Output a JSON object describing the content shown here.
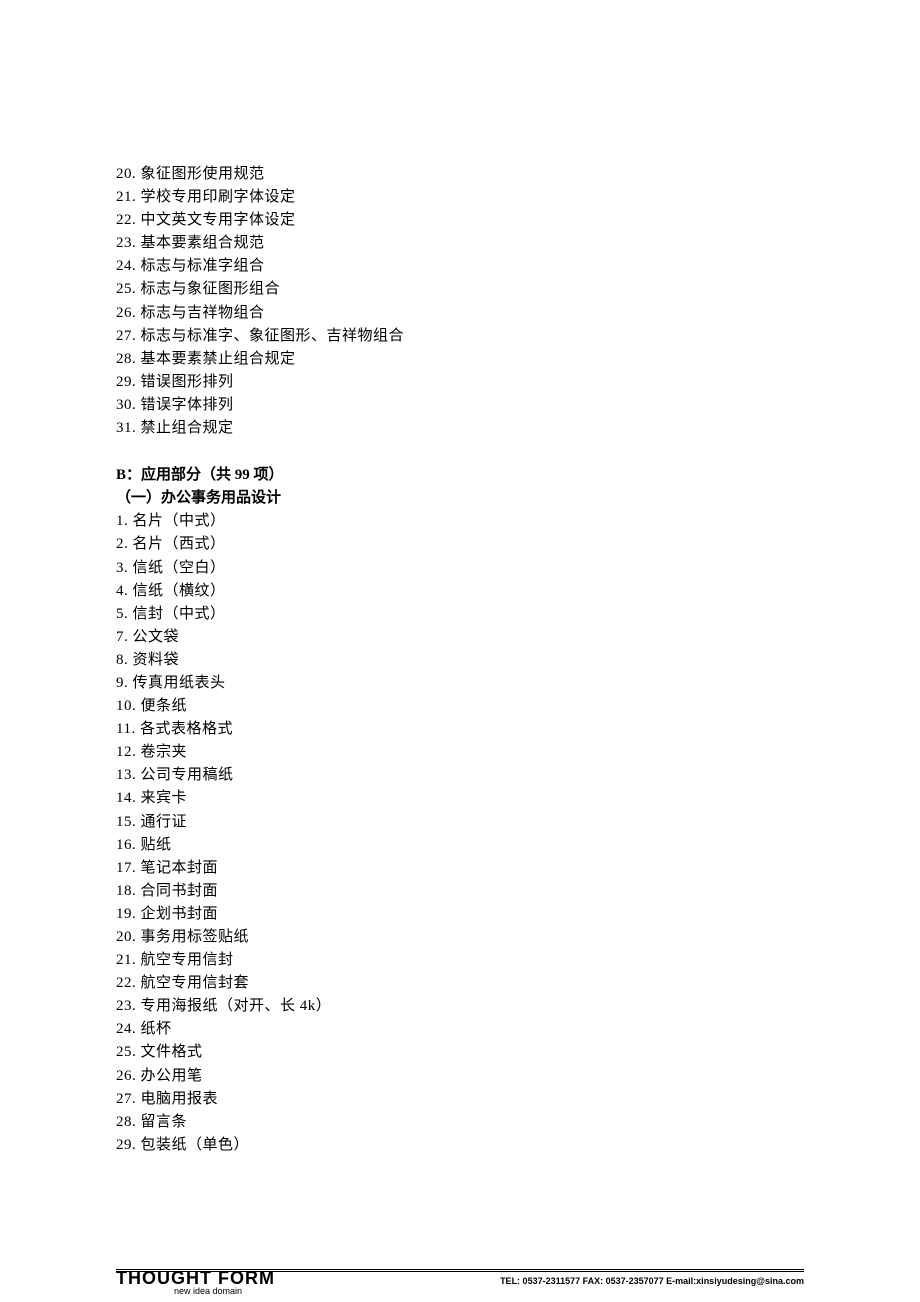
{
  "list1": [
    {
      "num": "20",
      "text": "象征图形使用规范"
    },
    {
      "num": "21",
      "text": "学校专用印刷字体设定"
    },
    {
      "num": "22",
      "text": "中文英文专用字体设定"
    },
    {
      "num": "23",
      "text": "基本要素组合规范"
    },
    {
      "num": "24",
      "text": "标志与标准字组合"
    },
    {
      "num": "25",
      "text": "标志与象征图形组合"
    },
    {
      "num": "26",
      "text": "标志与吉祥物组合"
    },
    {
      "num": "27",
      "text": "标志与标准字、象征图形、吉祥物组合"
    },
    {
      "num": "28",
      "text": "基本要素禁止组合规定"
    },
    {
      "num": "29",
      "text": "错误图形排列"
    },
    {
      "num": "30",
      "text": "错误字体排列"
    },
    {
      "num": "31",
      "text": "禁止组合规定"
    }
  ],
  "sectionB": {
    "header": "B：应用部分（共 99 项）",
    "subheader": "（一）办公事务用品设计"
  },
  "list2": [
    {
      "num": "1",
      "text": "名片（中式）"
    },
    {
      "num": "2",
      "text": "名片（西式）"
    },
    {
      "num": "3",
      "text": "信纸（空白）"
    },
    {
      "num": "4",
      "text": "信纸（横纹）"
    },
    {
      "num": "5",
      "text": "信封（中式）"
    },
    {
      "num": "7",
      "text": "公文袋"
    },
    {
      "num": "8",
      "text": "资料袋"
    },
    {
      "num": "9",
      "text": "传真用纸表头"
    },
    {
      "num": "10",
      "text": "便条纸"
    },
    {
      "num": "11",
      "text": "各式表格格式"
    },
    {
      "num": "12",
      "text": "卷宗夹"
    },
    {
      "num": "13",
      "text": "公司专用稿纸"
    },
    {
      "num": "14",
      "text": "来宾卡"
    },
    {
      "num": "15",
      "text": "通行证"
    },
    {
      "num": "16",
      "text": "贴纸"
    },
    {
      "num": "17",
      "text": "笔记本封面"
    },
    {
      "num": "18",
      "text": "合同书封面"
    },
    {
      "num": "19",
      "text": "企划书封面"
    },
    {
      "num": "20",
      "text": "事务用标签贴纸"
    },
    {
      "num": "21",
      "text": "航空专用信封"
    },
    {
      "num": "22",
      "text": "航空专用信封套"
    },
    {
      "num": "23",
      "text": "专用海报纸（对开、长 4k）"
    },
    {
      "num": "24",
      "text": "纸杯"
    },
    {
      "num": "25",
      "text": "文件格式"
    },
    {
      "num": "26",
      "text": "办公用笔"
    },
    {
      "num": "27",
      "text": "电脑用报表"
    },
    {
      "num": "28",
      "text": "留言条"
    },
    {
      "num": "29",
      "text": "包装纸（单色）"
    }
  ],
  "footer": {
    "logo": "THOUGHT FORM",
    "logoSub": "new idea domain",
    "contact": "TEL: 0537-2311577   FAX: 0537-2357077   E-mail:xinsiyudesing@sina.com"
  }
}
